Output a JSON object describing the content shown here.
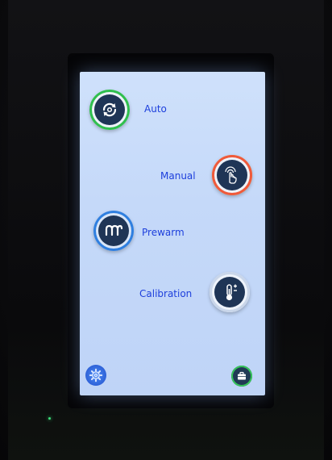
{
  "modes": {
    "auto": {
      "label": "Auto",
      "icon": "auto-cycle-icon"
    },
    "manual": {
      "label": "Manual",
      "icon": "hand-touch-icon"
    },
    "prewarm": {
      "label": "Prewarm",
      "icon": "heating-coil-icon"
    },
    "calibration": {
      "label": "Calibration",
      "icon": "thermometer-plus-minus-icon"
    }
  },
  "footer": {
    "settings_icon": "gear-icon",
    "briefcase_icon": "briefcase-icon"
  },
  "colors": {
    "screen_bg": "#c5d9f9",
    "label_text": "#1d3fdc",
    "button_core": "#1f3556",
    "auto_ring": "#2fbf4e",
    "manual_ring": "#ef5a3c",
    "prewarm_ring": "#2f7fe0",
    "settings_bg": "#2e62d8"
  }
}
